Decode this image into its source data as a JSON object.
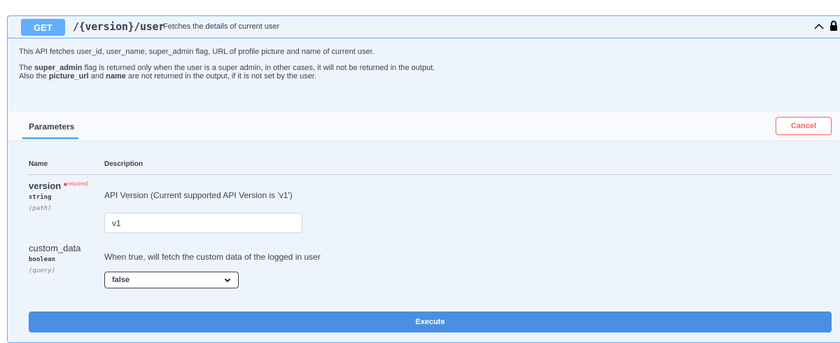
{
  "operation": {
    "method": "GET",
    "path": "/{version}/user",
    "summary": "Fetches the details of current user"
  },
  "description": {
    "line1": "This API fetches user_id, user_name, super_admin flag, URL of profile picture and name of current user.",
    "line2_pre": "The ",
    "line2_bold": "super_admin",
    "line2_post": " flag is returned only when the user is a super admin, in other cases, it will not be returned in the output.",
    "line3_pre": "Also the ",
    "line3_bold1": "picture_url",
    "line3_mid": " and ",
    "line3_bold2": "name",
    "line3_post": " are not returned in the output, if it is not set by the user."
  },
  "parameters": {
    "tab_label": "Parameters",
    "cancel_label": "Cancel",
    "col_name": "Name",
    "col_description": "Description",
    "items": [
      {
        "name": "version",
        "required_star": "*",
        "required_text": "required",
        "type": "string",
        "in": "(path)",
        "description": "API Version (Current supported API Version is 'v1')",
        "value": "v1"
      },
      {
        "name": "custom_data",
        "type": "boolean",
        "in": "(query)",
        "description": "When true, will fetch the custom data of the logged in user",
        "selected": "false"
      }
    ]
  },
  "execute_label": "Execute",
  "colors": {
    "accent": "#61affe",
    "execute": "#4990e2",
    "cancel": "#ff6060",
    "required": "#ff2020"
  }
}
